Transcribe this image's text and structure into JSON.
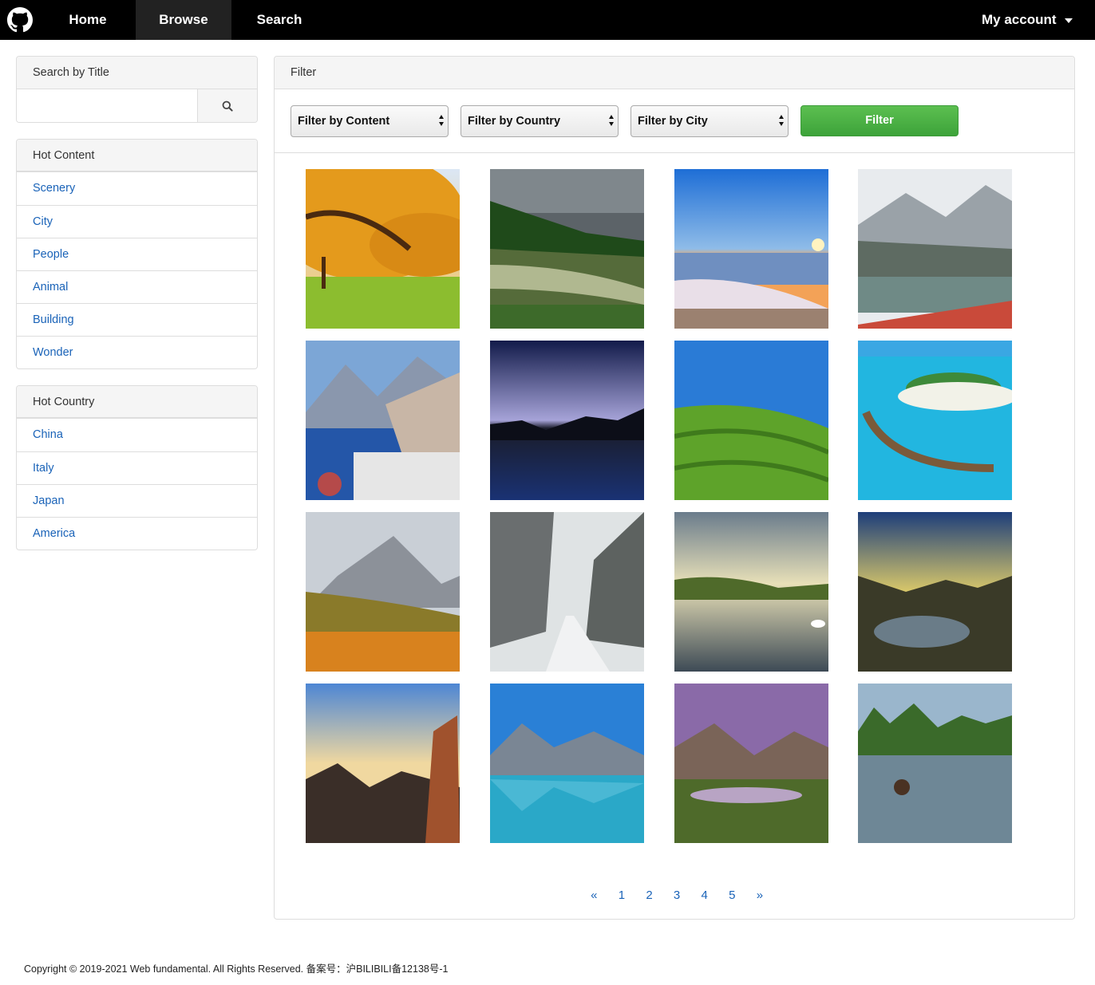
{
  "nav": {
    "logo_icon": "github-octocat-icon",
    "home": "Home",
    "browse": "Browse",
    "search": "Search",
    "account": "My account"
  },
  "sidebar": {
    "search_title": "Search by Title",
    "search_value": "",
    "search_icon": "magnifier-icon",
    "hot_content": {
      "title": "Hot Content",
      "items": [
        "Scenery",
        "City",
        "People",
        "Animal",
        "Building",
        "Wonder"
      ]
    },
    "hot_country": {
      "title": "Hot Country",
      "items": [
        "China",
        "Italy",
        "Japan",
        "America"
      ]
    }
  },
  "filter": {
    "title": "Filter",
    "content_select": "Filter by Content",
    "country_select": "Filter by Country",
    "city_select": "Filter by City",
    "button": "Filter",
    "button_color": "#4cb045"
  },
  "gallery": [
    {
      "alt": "autumn tree park"
    },
    {
      "alt": "forest river"
    },
    {
      "alt": "sunset beach waves"
    },
    {
      "alt": "snowy mountain lake"
    },
    {
      "alt": "lakeside village"
    },
    {
      "alt": "night lake mountains"
    },
    {
      "alt": "green tea hills"
    },
    {
      "alt": "island resort water villas"
    },
    {
      "alt": "misty alpine meadow"
    },
    {
      "alt": "snowy canyon road"
    },
    {
      "alt": "lake with swan"
    },
    {
      "alt": "mountain bay sunset"
    },
    {
      "alt": "cliff above clouds"
    },
    {
      "alt": "turquoise mountain lake"
    },
    {
      "alt": "purple sky mountains"
    },
    {
      "alt": "karst river buffalo"
    }
  ],
  "pager": {
    "prev": "«",
    "pages": [
      "1",
      "2",
      "3",
      "4",
      "5"
    ],
    "next": "»"
  },
  "footer": {
    "text": "Copyright © 2019-2021 Web fundamental. All Rights Reserved. 备案号：沪BILIBILI备12138号-1"
  },
  "colors": {
    "nav_bg": "#000000",
    "nav_active": "#222222",
    "link": "#1a63b8",
    "panel_head_bg": "#f5f5f5"
  }
}
